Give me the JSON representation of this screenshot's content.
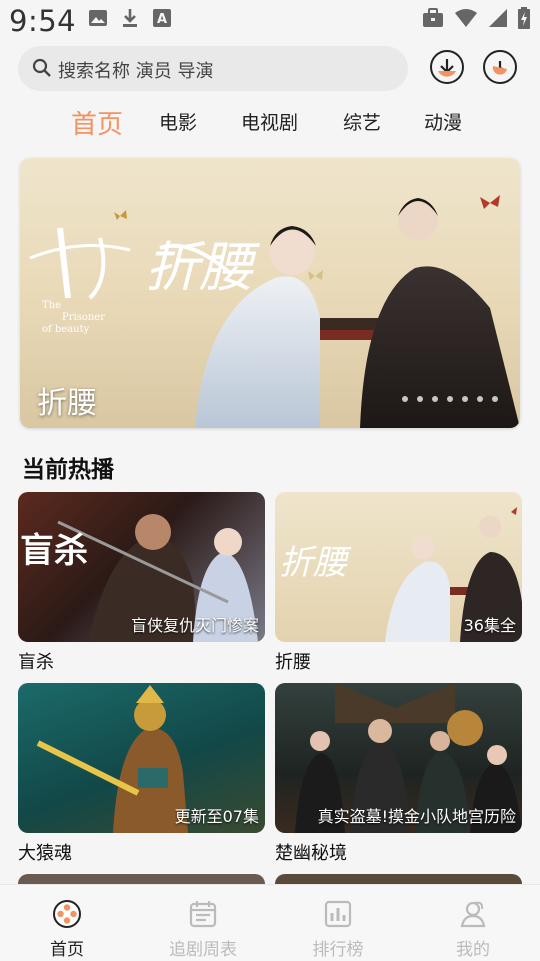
{
  "status": {
    "time": "9:54",
    "left_icons": [
      "image-icon",
      "download-icon",
      "text-icon"
    ],
    "right_icons": [
      "briefcase-icon",
      "wifi-icon",
      "signal-icon",
      "battery-charging-icon"
    ]
  },
  "search": {
    "placeholder": "搜索名称 演员 导演",
    "download_icon": "download-icon",
    "history_icon": "history-icon"
  },
  "tabs": [
    {
      "label": "首页",
      "active": true
    },
    {
      "label": "电影",
      "active": false
    },
    {
      "label": "电视剧",
      "active": false
    },
    {
      "label": "综艺",
      "active": false
    },
    {
      "label": "动漫",
      "active": false
    }
  ],
  "banner": {
    "title": "折腰",
    "art_text": "折腰",
    "english_title": [
      "The",
      "Prisoner",
      "of beauty"
    ],
    "dot_count": 7
  },
  "section": {
    "title": "当前热播"
  },
  "cards": [
    {
      "name": "盲杀",
      "badge": "盲侠复仇灭门惨案",
      "art_text": "盲杀"
    },
    {
      "name": "折腰",
      "badge": "36集全",
      "art_text": "折腰"
    },
    {
      "name": "大猿魂",
      "badge": "更新至07集"
    },
    {
      "name": "楚幽秘境",
      "badge": "真实盗墓!摸金小队地宫历险"
    }
  ],
  "bottom_nav": [
    {
      "label": "首页",
      "icon": "film-reel-icon",
      "active": true
    },
    {
      "label": "追剧周表",
      "icon": "calendar-icon",
      "active": false
    },
    {
      "label": "排行榜",
      "icon": "ranking-chart-icon",
      "active": false
    },
    {
      "label": "我的",
      "icon": "profile-icon",
      "active": false
    }
  ],
  "colors": {
    "accent": "#f29361",
    "inactive": "#bbbbbb"
  }
}
